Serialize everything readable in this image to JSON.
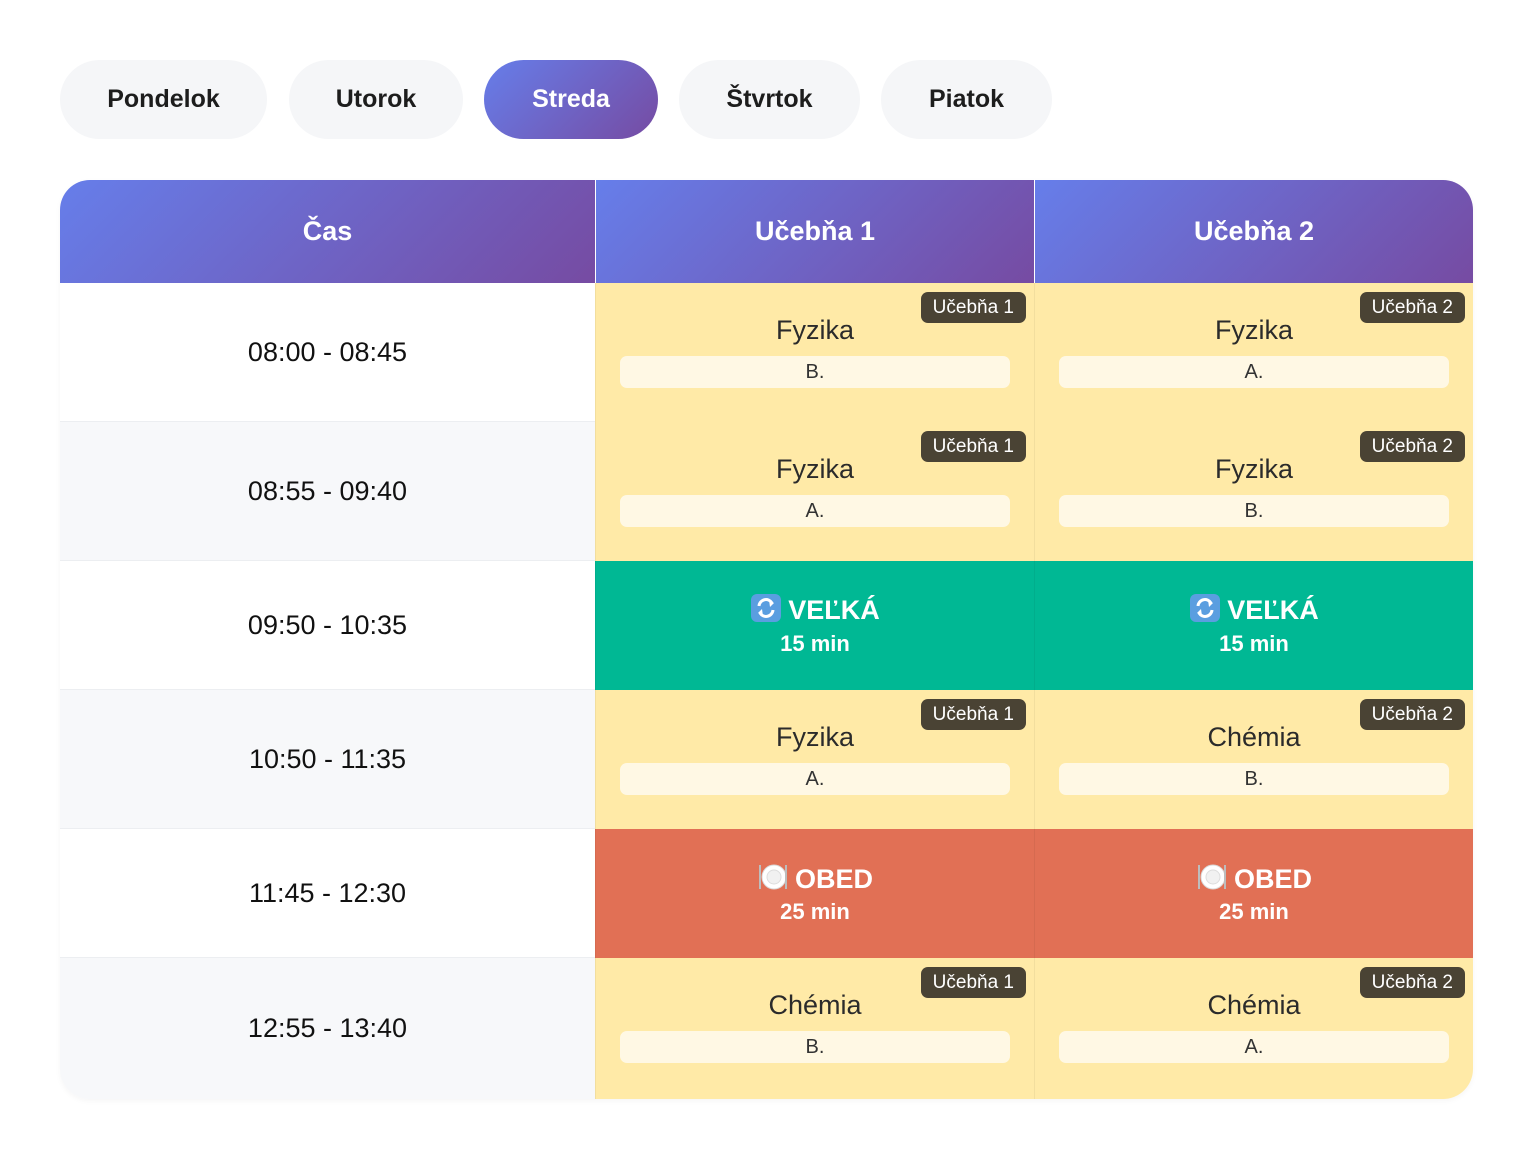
{
  "tabs": [
    {
      "label": "Pondelok",
      "active": false
    },
    {
      "label": "Utorok",
      "active": false
    },
    {
      "label": "Streda",
      "active": true
    },
    {
      "label": "Štvrtok",
      "active": false
    },
    {
      "label": "Piatok",
      "active": false
    }
  ],
  "table": {
    "headers": [
      "Čas",
      "Učebňa 1",
      "Učebňa 2"
    ],
    "rows": [
      {
        "time": "08:00 - 08:45",
        "cells": [
          {
            "type": "lesson",
            "room": "Učebňa 1",
            "subject": "Fyzika",
            "group": "B."
          },
          {
            "type": "lesson",
            "room": "Učebňa 2",
            "subject": "Fyzika",
            "group": "A."
          }
        ]
      },
      {
        "time": "08:55 - 09:40",
        "cells": [
          {
            "type": "lesson",
            "room": "Učebňa 1",
            "subject": "Fyzika",
            "group": "A."
          },
          {
            "type": "lesson",
            "room": "Učebňa 2",
            "subject": "Fyzika",
            "group": "B."
          }
        ]
      },
      {
        "time": "09:50 - 10:35",
        "cells": [
          {
            "type": "break",
            "icon": "refresh-icon",
            "title": "VEĽKÁ",
            "duration": "15 min"
          },
          {
            "type": "break",
            "icon": "refresh-icon",
            "title": "VEĽKÁ",
            "duration": "15 min"
          }
        ]
      },
      {
        "time": "10:50 - 11:35",
        "cells": [
          {
            "type": "lesson",
            "room": "Učebňa 1",
            "subject": "Fyzika",
            "group": "A."
          },
          {
            "type": "lesson",
            "room": "Učebňa 2",
            "subject": "Chémia",
            "group": "B."
          }
        ]
      },
      {
        "time": "11:45 - 12:30",
        "cells": [
          {
            "type": "lunch",
            "icon": "plate-icon",
            "title": "OBED",
            "duration": "25 min"
          },
          {
            "type": "lunch",
            "icon": "plate-icon",
            "title": "OBED",
            "duration": "25 min"
          }
        ]
      },
      {
        "time": "12:55 - 13:40",
        "cells": [
          {
            "type": "lesson",
            "room": "Učebňa 1",
            "subject": "Chémia",
            "group": "B."
          },
          {
            "type": "lesson",
            "room": "Učebňa 2",
            "subject": "Chémia",
            "group": "A."
          }
        ]
      }
    ]
  },
  "colors": {
    "header_gradient_start": "#667eea",
    "header_gradient_end": "#764ba2",
    "lesson": "#ffeaa7",
    "velka_break": "#00b894",
    "lunch": "#e17055",
    "room_badge": "#4a4334"
  }
}
